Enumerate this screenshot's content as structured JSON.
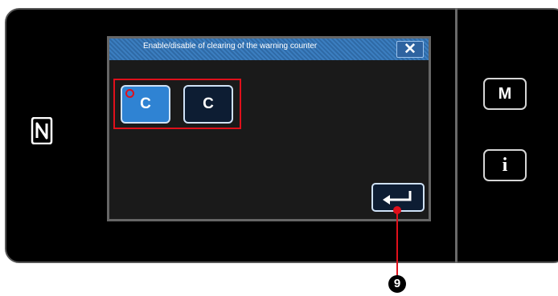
{
  "dialog": {
    "title": "Enable/disable of clearing of the warning counter",
    "close_glyph": "✕",
    "enter_icon": "enter-return-icon"
  },
  "options": [
    {
      "label": "C",
      "state": "selected",
      "color": "#2f83d3",
      "has_warning_mark": true
    },
    {
      "label": "C",
      "state": "unselected",
      "color": "#0d1d33"
    }
  ],
  "side_buttons": {
    "m_label": "M",
    "info_label": "i"
  },
  "annotation": {
    "callout_number": "9",
    "highlight_color": "#e0101b"
  },
  "branding": {
    "icon": "nfc-icon"
  }
}
